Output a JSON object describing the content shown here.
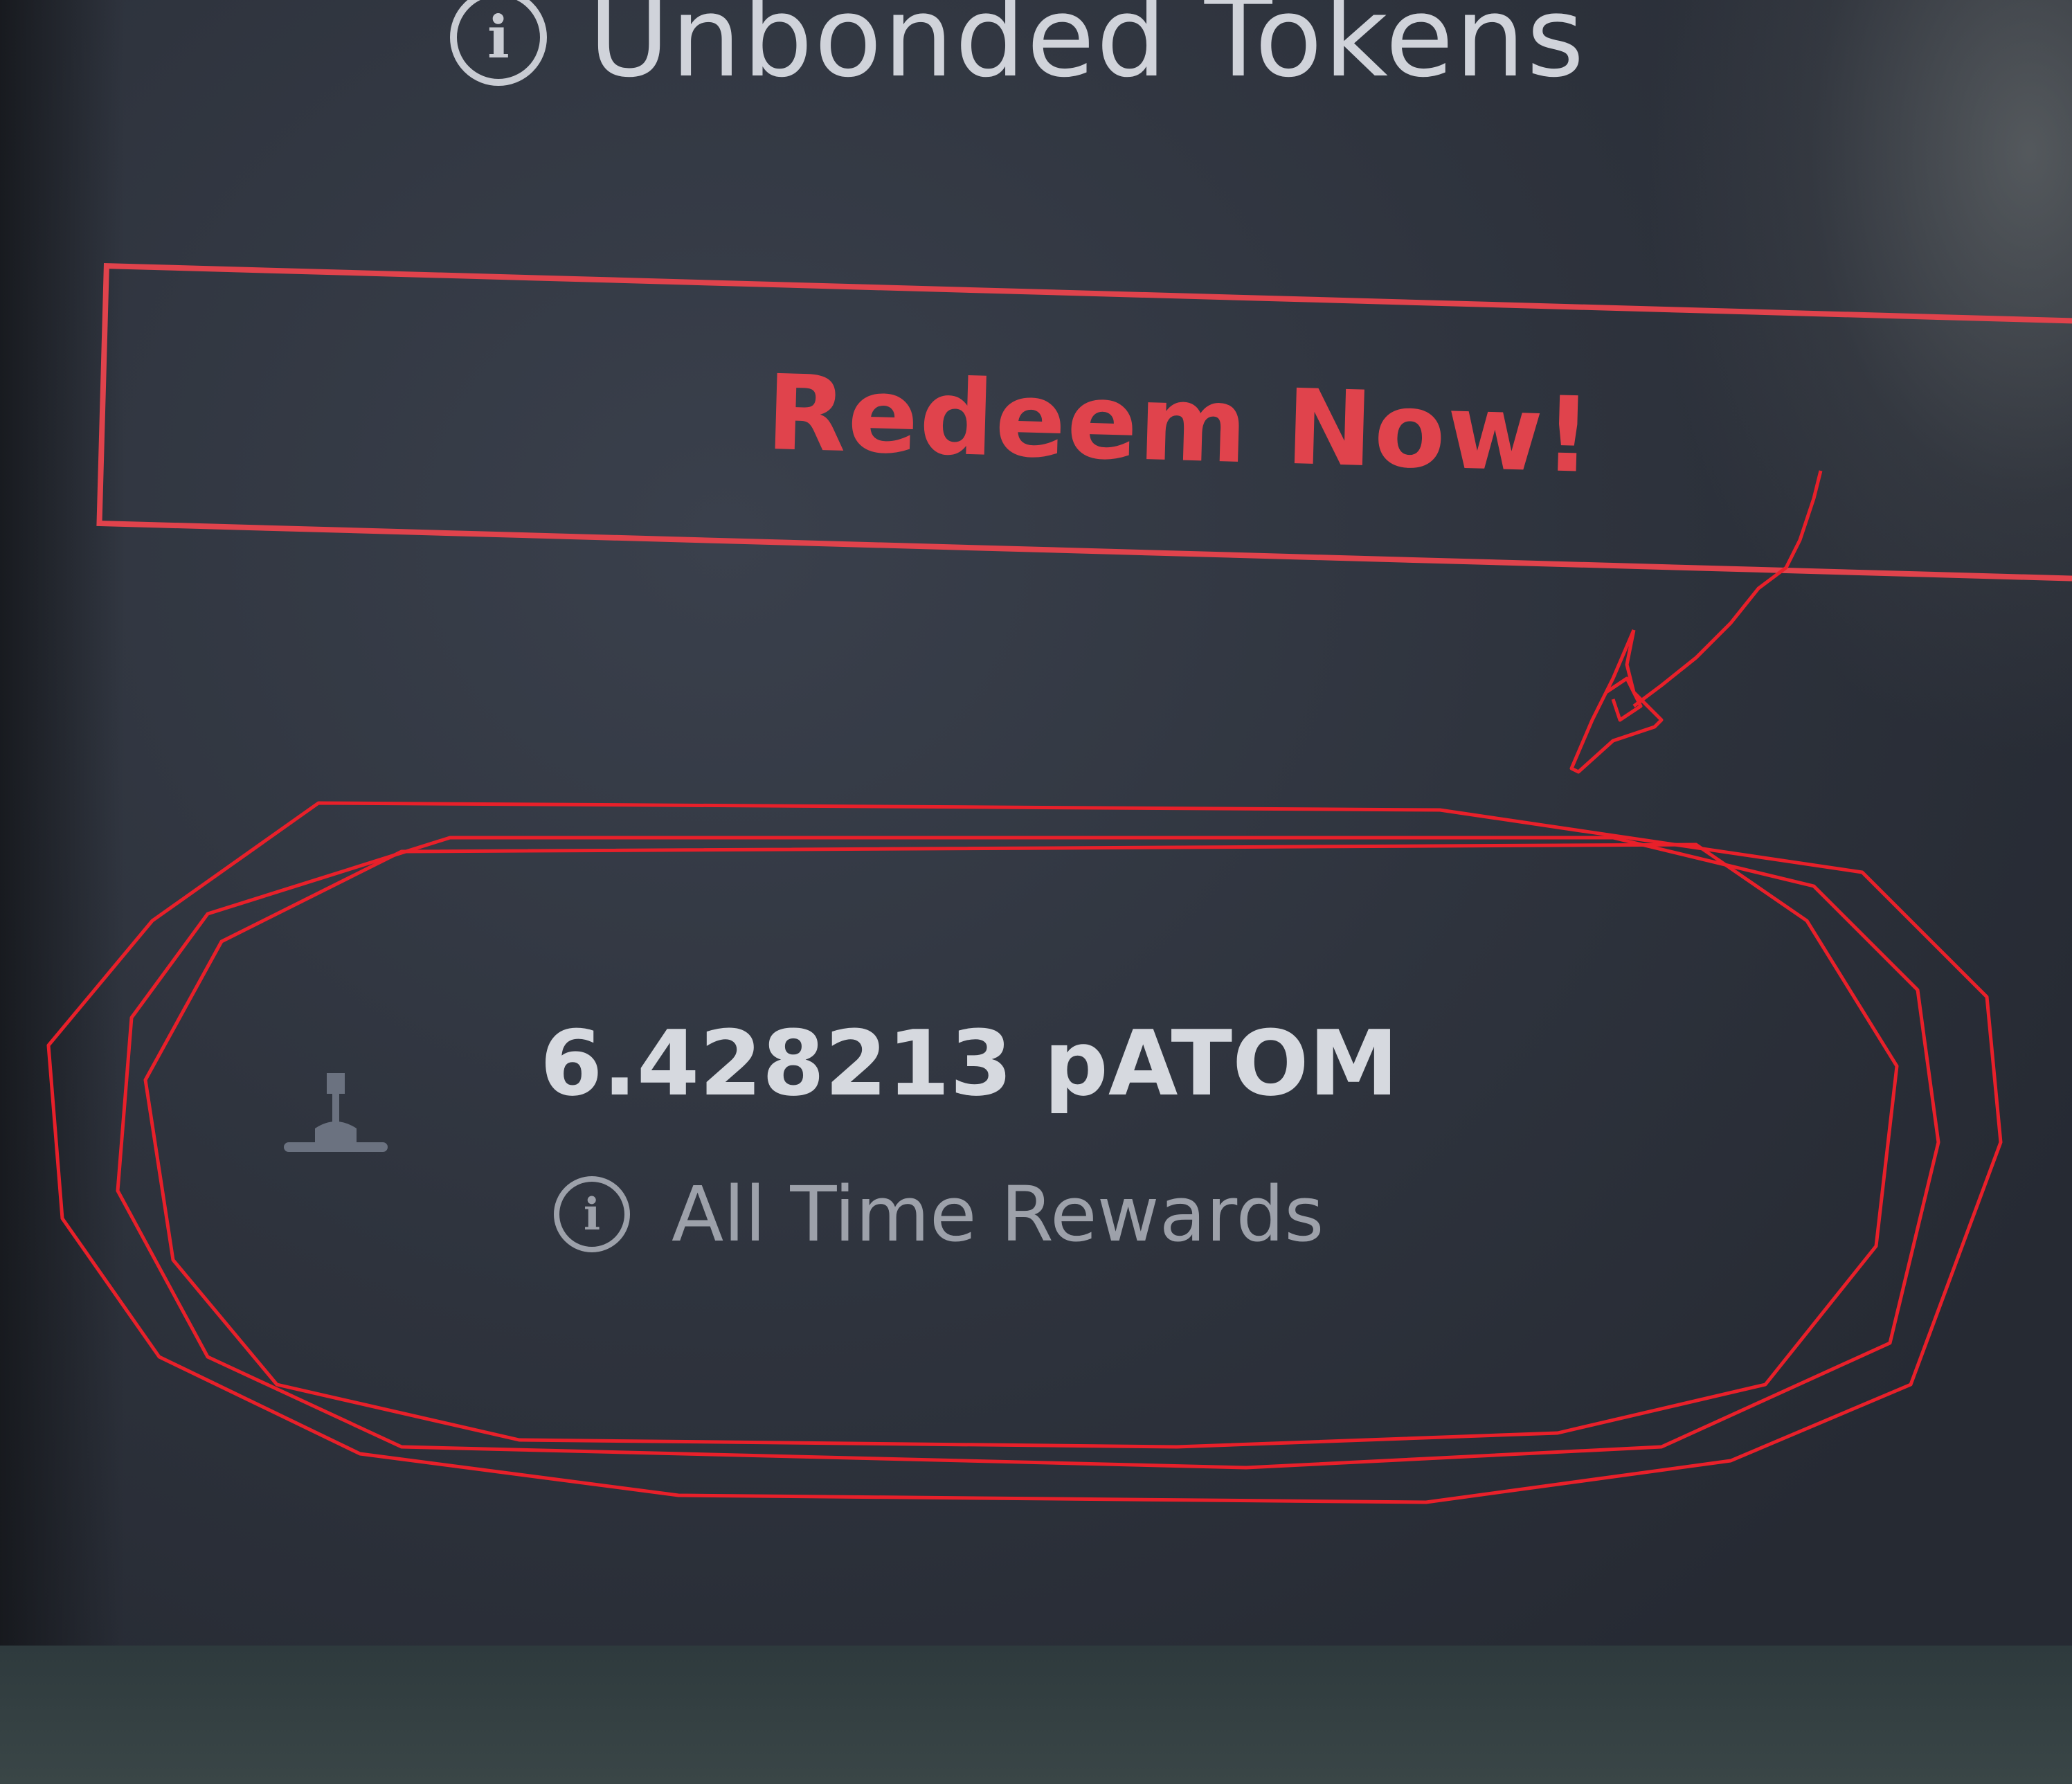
{
  "unbonded": {
    "label": "Unbonded Tokens",
    "icon": "info-icon"
  },
  "redeem": {
    "label": "Redeem Now!",
    "color": "#e0434c"
  },
  "rewards": {
    "amount": "6.428213 pATOM",
    "label": "All Time Rewards",
    "icon": "info-icon",
    "badge_icon": "award-icon"
  },
  "annotation": {
    "color": "#e8202a",
    "shapes": [
      "ellipse",
      "arrow"
    ]
  }
}
